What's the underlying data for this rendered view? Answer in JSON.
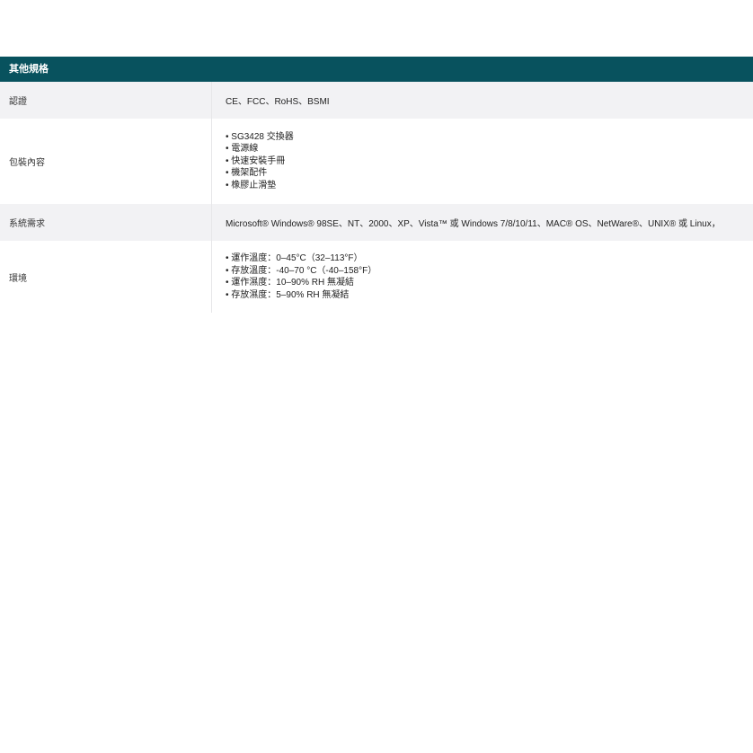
{
  "section": {
    "title": "其他規格"
  },
  "rows": [
    {
      "label": "認證",
      "value": "CE、FCC、RoHS、BSMI"
    },
    {
      "label": "包裝內容",
      "items": [
        "SG3428 交換器",
        "電源線",
        "快速安裝手冊",
        "機架配件",
        "橡膠止滑墊"
      ]
    },
    {
      "label": "系統需求",
      "value": "Microsoft® Windows® 98SE、NT、2000、XP、Vista™ 或 Windows 7/8/10/11、MAC® OS、NetWare®、UNIX® 或 Linux，"
    },
    {
      "label": "環境",
      "items": [
        "運作溫度：0–45°C（32–113°F）",
        "存放溫度：-40–70 °C（-40–158°F）",
        "運作濕度：10–90% RH 無凝結",
        "存放濕度：5–90% RH 無凝結"
      ]
    }
  ]
}
